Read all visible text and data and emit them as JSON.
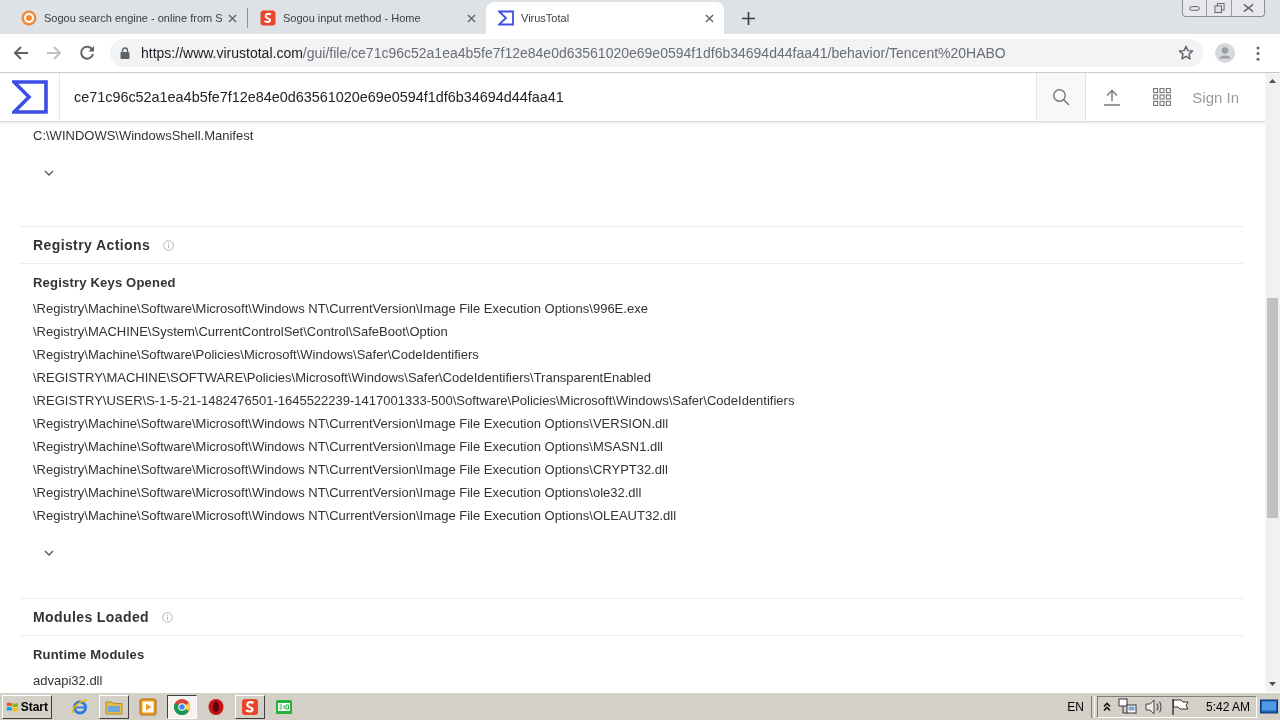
{
  "browser": {
    "tabs": [
      {
        "title": "Sogou search engine - online from S",
        "kind": "search",
        "selected": false
      },
      {
        "title": "Sogou input method - Home",
        "kind": "ime",
        "selected": false
      },
      {
        "title": "VirusTotal",
        "kind": "scanner",
        "selected": true
      }
    ],
    "back_disabled": false,
    "forward_disabled": true,
    "url_host": "https://www.virustotal.com",
    "url_path": "/gui/file/ce71c96c52a1ea4b5fe7f12e84e0d63561020e69e0594f1df6b34694d44faa41/behavior/Tencent%20HABO"
  },
  "header": {
    "search_value": "ce71c96c52a1ea4b5fe7f12e84e0d63561020e69e0594f1df6b34694d44faa41",
    "sign_in": "Sign In"
  },
  "content": {
    "previous_items": [
      "C:\\WINDOWS\\WindowsShell.Manifest"
    ],
    "previous_show_more": true,
    "sections": [
      {
        "title": "Registry Actions",
        "groups": [
          {
            "title": "Registry Keys Opened",
            "show_more": true,
            "items": [
              "\\Registry\\Machine\\Software\\Microsoft\\Windows NT\\CurrentVersion\\Image File Execution Options\\996E.exe",
              "\\Registry\\MACHINE\\System\\CurrentControlSet\\Control\\SafeBoot\\Option",
              "\\Registry\\Machine\\Software\\Policies\\Microsoft\\Windows\\Safer\\CodeIdentifiers",
              "\\REGISTRY\\MACHINE\\SOFTWARE\\Policies\\Microsoft\\Windows\\Safer\\CodeIdentifiers\\TransparentEnabled",
              "\\REGISTRY\\USER\\S-1-5-21-1482476501-1645522239-1417001333-500\\Software\\Policies\\Microsoft\\Windows\\Safer\\CodeIdentifiers",
              "\\Registry\\Machine\\Software\\Microsoft\\Windows NT\\CurrentVersion\\Image File Execution Options\\VERSION.dll",
              "\\Registry\\Machine\\Software\\Microsoft\\Windows NT\\CurrentVersion\\Image File Execution Options\\MSASN1.dll",
              "\\Registry\\Machine\\Software\\Microsoft\\Windows NT\\CurrentVersion\\Image File Execution Options\\CRYPT32.dll",
              "\\Registry\\Machine\\Software\\Microsoft\\Windows NT\\CurrentVersion\\Image File Execution Options\\ole32.dll",
              "\\Registry\\Machine\\Software\\Microsoft\\Windows NT\\CurrentVersion\\Image File Execution Options\\OLEAUT32.dll"
            ]
          }
        ]
      },
      {
        "title": "Modules Loaded",
        "groups": [
          {
            "title": "Runtime Modules",
            "items": [
              "advapi32.dll"
            ]
          }
        ]
      }
    ]
  },
  "taskbar": {
    "start": "Start",
    "apps": [
      {
        "kind": "ie",
        "running": false,
        "selected": false
      },
      {
        "kind": "folder",
        "running": true,
        "selected": false
      },
      {
        "kind": "player",
        "running": false,
        "selected": false
      },
      {
        "kind": "chrome",
        "running": true,
        "selected": true
      },
      {
        "kind": "opera",
        "running": false,
        "selected": false
      },
      {
        "kind": "sogou",
        "running": true,
        "selected": false
      },
      {
        "kind": "chat",
        "running": false,
        "selected": false
      }
    ],
    "language": "EN",
    "clock": "5:42 AM"
  }
}
